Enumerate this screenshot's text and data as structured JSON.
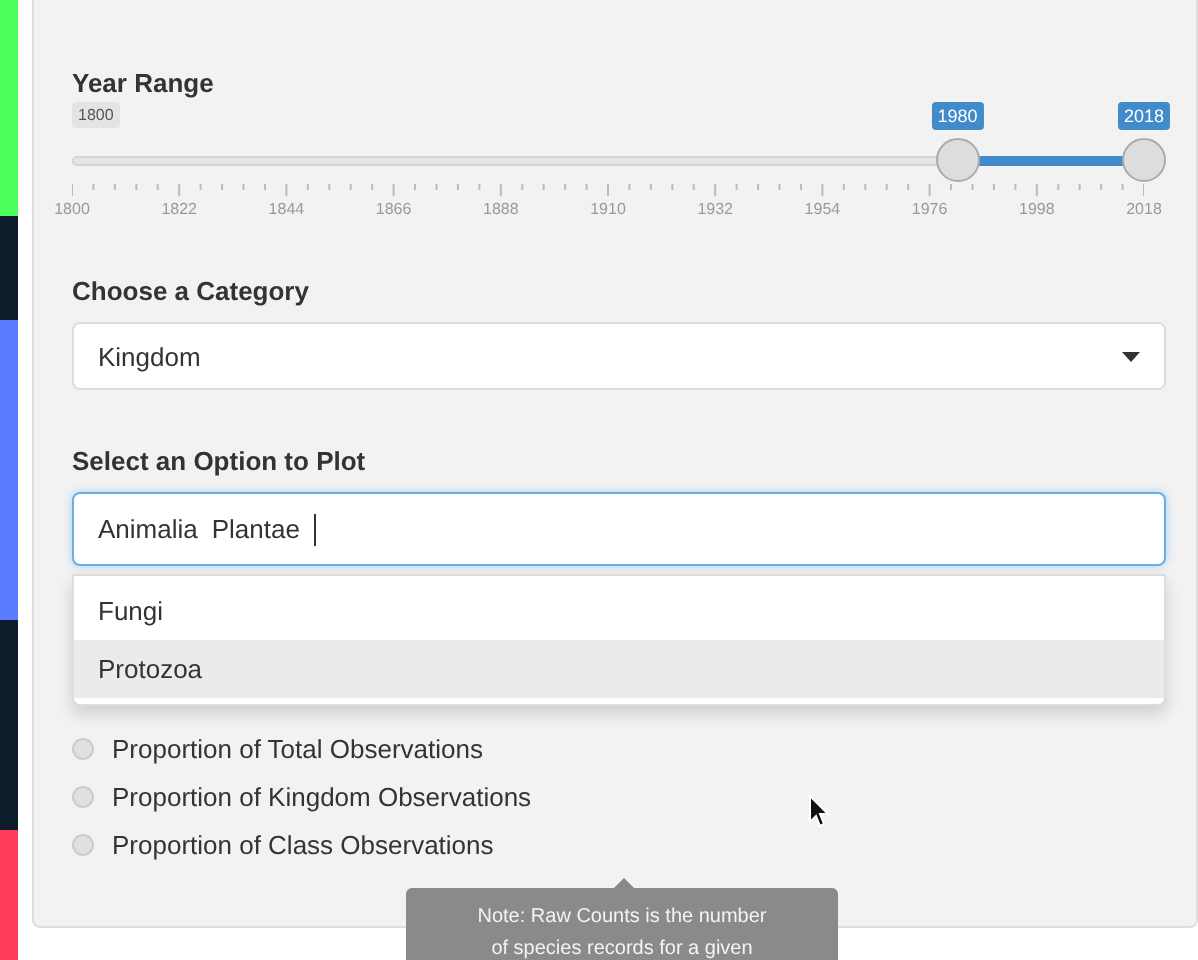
{
  "panel": {
    "year_range": {
      "label": "Year Range",
      "min_label": "1800",
      "handles": [
        {
          "value": "1980",
          "level": 0.826
        },
        {
          "value": "2018",
          "level": 1
        }
      ],
      "ticks": [
        "1800",
        "1822",
        "1844",
        "1866",
        "1888",
        "1910",
        "1932",
        "1954",
        "1976",
        "1998",
        "2018"
      ]
    },
    "category": {
      "label": "Choose a Category",
      "value": "Kingdom"
    },
    "plot_option": {
      "label": "Select an Option to Plot",
      "chosen": [
        "Animalia",
        "Plantae"
      ],
      "options": [
        {
          "label": "Fungi",
          "selected": false
        },
        {
          "label": "Protozoa",
          "selected": true
        }
      ]
    },
    "measure": {
      "options": [
        {
          "label": "Proportion of Total Observations",
          "selected": false
        },
        {
          "label": "Proportion of Kingdom Observations",
          "selected": false
        },
        {
          "label": "Proportion of Class Observations",
          "selected": false
        }
      ]
    },
    "tooltip": {
      "lines": [
        "Note: Raw Counts is the number",
        "of species records for a given"
      ]
    }
  }
}
